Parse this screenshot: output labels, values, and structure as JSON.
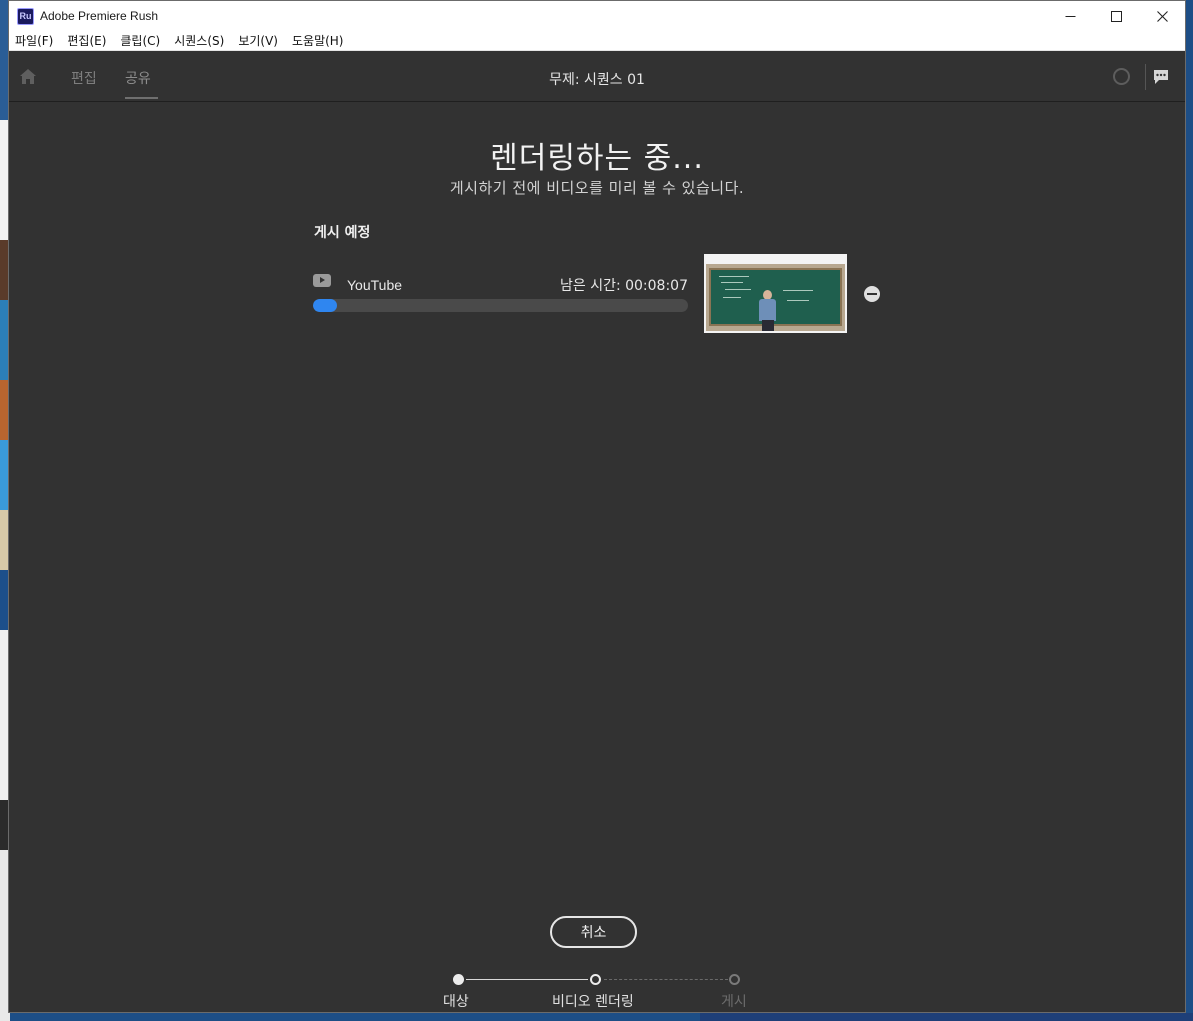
{
  "window": {
    "app_icon_text": "Ru",
    "title": "Adobe Premiere Rush"
  },
  "menu": [
    "파일(F)",
    "편집(E)",
    "클립(C)",
    "시퀀스(S)",
    "보기(V)",
    "도움말(H)"
  ],
  "header": {
    "tabs": [
      "편집",
      "공유"
    ],
    "active_tab": "공유",
    "project_title": "무제: 시퀀스 01"
  },
  "render": {
    "heading": "렌더링하는 중...",
    "subheading": "게시하기 전에 비디오를 미리 볼 수 있습니다.",
    "section_label": "게시 예정",
    "destination": "YouTube",
    "time_remaining": "남은 시간: 00:08:07",
    "progress": 0.065
  },
  "actions": {
    "cancel_label": "취소"
  },
  "steps": [
    {
      "label": "대상",
      "state": "done"
    },
    {
      "label": "비디오 렌더링",
      "state": "current"
    },
    {
      "label": "게시",
      "state": "todo"
    }
  ],
  "colors": {
    "accent": "#2f86f0",
    "background": "#323232"
  }
}
